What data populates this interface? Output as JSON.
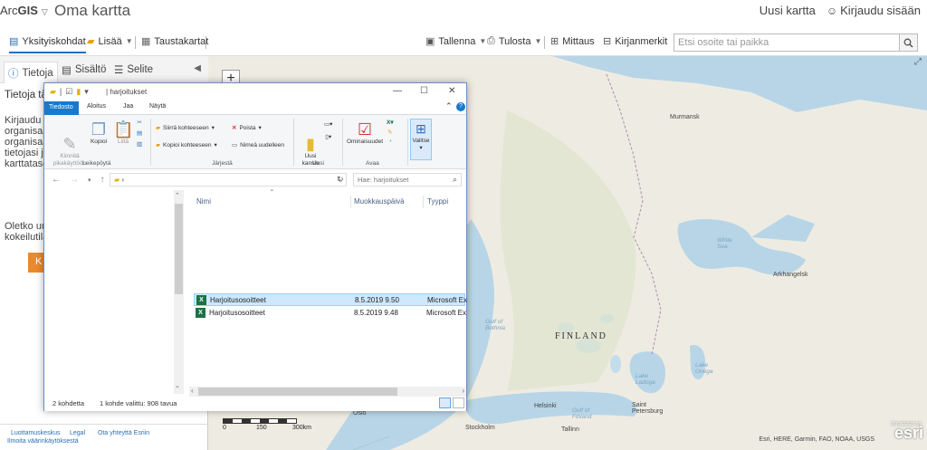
{
  "header": {
    "brand_prefix": "Arc",
    "brand_bold": "GIS",
    "map_title": "Oma kartta",
    "new_map": "Uusi kartta",
    "sign_in": "Kirjaudu sisään"
  },
  "toolbar": {
    "details": "Yksityiskohdat",
    "add": "Lisää",
    "basemap": "Taustakartat",
    "save": "Tallenna",
    "print": "Tulosta",
    "measure": "Mittaus",
    "bookmarks": "Kirjanmerkit",
    "search_placeholder": "Etsi osoite tai paikka"
  },
  "left_panel": {
    "tabs": [
      "Tietoja",
      "Sisältö",
      "Selite"
    ],
    "heading": "Tietoja täst",
    "para1": [
      "Kirjaudu s",
      "organisaat",
      "organisaat",
      "tietojasi ja",
      "karttatasoj"
    ],
    "para2": [
      "Oletko uu",
      "kokeilutila"
    ],
    "orange_btn": "K",
    "footer": {
      "trust": "Luottamuskeskus",
      "legal": "Legal",
      "contact": "Ota yhteyttä Esriin",
      "report": "Ilmoita väärinkäytöksestä"
    }
  },
  "map": {
    "labels": {
      "murmansk": "Murmansk",
      "white_sea": "White\nSea",
      "arkhangelsk": "Arkhangelsk",
      "finland": "FINLAND",
      "gulf_bothnia": "Gulf of\nBothnia",
      "lake_ladoga": "Lake\nLadoga",
      "lake_onega": "Lake\nOnega",
      "helsinki": "Helsinki",
      "st_petersburg": "Saint\nPetersburg",
      "gulf_finland": "Gulf of\nFinland",
      "oslo": "Oslo",
      "stockholm": "Stockholm",
      "tallinn": "Tallinn"
    },
    "scale": {
      "s0": "0",
      "s1": "150",
      "s2": "300km"
    },
    "attribution": "Esri, HERE, Garmin, FAO, NOAA, USGS",
    "esri": "esri",
    "powered": "POWERED BY"
  },
  "explorer": {
    "path": "harjoitukset",
    "ribbon_tabs": [
      "Tiedosto",
      "Aloitus",
      "Jaa",
      "Näytä"
    ],
    "ribbon": {
      "pin": "Kiinnitä\npikakäyttöön",
      "copy": "Kopioi",
      "paste": "Liitä",
      "move_to": "Siirrä kohteeseen",
      "copy_to": "Kopioi kohteeseen",
      "delete": "Poista",
      "rename": "Nimeä uudelleen",
      "new_folder": "Uusi\nkansio",
      "properties": "Ominaisuudet",
      "select": "Valitse",
      "group_clipboard": "Leikepöytä",
      "group_organize": "Järjestä",
      "group_new": "Uusi",
      "group_open": "Avaa"
    },
    "search_placeholder": "Hae: harjoitukset",
    "columns": [
      "Nimi",
      "Muokkauspäivä",
      "Tyyppi"
    ],
    "files": [
      {
        "name": "Harjoitusosoitteet",
        "date": "8.5.2019 9.50",
        "type": "Microsoft Ex"
      },
      {
        "name": "Harjoitusosoitteet",
        "date": "8.5.2019 9.48",
        "type": "Microsoft Ex"
      }
    ],
    "status_count": "2 kohdetta",
    "status_selected": "1 kohde valittu: 908 tavua"
  }
}
